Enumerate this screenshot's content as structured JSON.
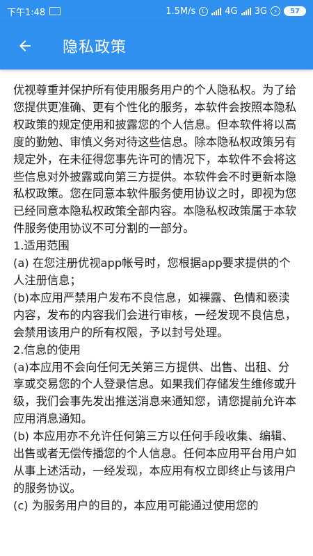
{
  "status_bar": {
    "time": "下午1:48",
    "notification_glyph": "•••",
    "speed": "1.5M/s",
    "network1": "4G",
    "network2": "3G",
    "battery": "57",
    "icons": [
      "chat-icon",
      "alarm-icon",
      "signal-icon",
      "charging-icon",
      "battery-icon"
    ]
  },
  "app_bar": {
    "title": "隐私政策",
    "back_icon": "arrow-left-icon",
    "color": "#2f90f0"
  },
  "content": {
    "paragraphs": [
      "优视尊重并保护所有使用服务用户的个人隐私权。为了给您提供更准确、更有个性化的服务，本软件会按照本隐私权政策的规定使用和披露您的个人信息。但本软件将以高度的勤勉、审慎义务对待这些信息。除本隐私权政策另有规定外，在未征得您事先许可的情况下，本软件不会将这些信息对外披露或向第三方提供。本软件会不时更新本隐私权政策。您在同意本软件服务使用协议之时，即视为您已经同意本隐私权政策全部内容。本隐私权政策属于本软件服务使用协议不可分割的一部分。",
      "1.适用范围",
      "(a) 在您注册优视app帐号时，您根据app要求提供的个人注册信息；",
      "(b)本应用严禁用户发布不良信息，如裸露、色情和亵渎内容，发布的内容我们会进行审核，一经发现不良信息，会禁用该用户的所有权限，予以封号处理。",
      "2.信息的使用",
      "(a)本应用不会向任何无关第三方提供、出售、出租、分享或交易您的个人登录信息。如果我们存储发生维修或升级，我们会事先发出推送消息来通知您，请您提前允许本应用消息通知。",
      "(b) 本应用亦不允许任何第三方以任何手段收集、编辑、出售或者无偿传播您的个人信息。任何本应用平台用户如从事上述活动，一经发现，本应用有权立即终止与该用户的服务协议。",
      "(c) 为服务用户的目的，本应用可能通过使用您的"
    ]
  }
}
